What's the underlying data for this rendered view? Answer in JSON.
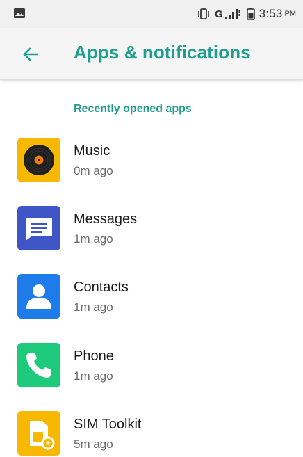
{
  "status_bar": {
    "network_type": "G",
    "time": "3:53",
    "ampm": "PM"
  },
  "app_bar": {
    "title": "Apps & notifications"
  },
  "section": {
    "header": "Recently opened apps"
  },
  "apps": [
    {
      "name": "Music",
      "time": "0m ago",
      "icon": "music-disc-icon",
      "color": "#F9B800"
    },
    {
      "name": "Messages",
      "time": "1m ago",
      "icon": "messages-icon",
      "color": "#3F57C6"
    },
    {
      "name": "Contacts",
      "time": "1m ago",
      "icon": "contacts-icon",
      "color": "#1E7BEA"
    },
    {
      "name": "Phone",
      "time": "1m ago",
      "icon": "phone-icon",
      "color": "#1DC97A"
    },
    {
      "name": "SIM Toolkit",
      "time": "5m ago",
      "icon": "sim-toolkit-icon",
      "color": "#F9B800"
    }
  ],
  "colors": {
    "accent": "#1F9E8F"
  }
}
